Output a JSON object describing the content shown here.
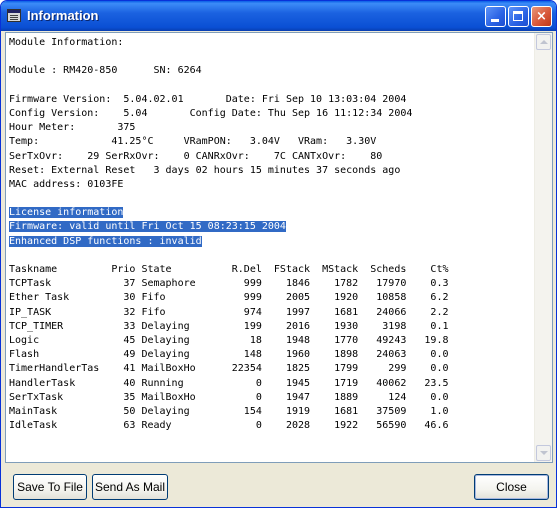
{
  "window": {
    "title": "Information",
    "icon": "terminal-window-icon",
    "controls": {
      "minimize": "minimize",
      "maximize": "maximize",
      "close": "×"
    }
  },
  "report": {
    "lines": [
      "Module Information:",
      "",
      "Module : RM420-850      SN: 6264",
      "",
      "Firmware Version:  5.04.02.01       Date: Fri Sep 10 13:03:04 2004",
      "Config Version:    5.04       Config Date: Thu Sep 16 11:12:34 2004",
      "Hour Meter:       375",
      "Temp:            41.25°C     VRamPON:   3.04V   VRam:   3.30V",
      "SerTxOvr:    29 SerRxOvr:    0 CANRxOvr:    7C CANTxOvr:    80",
      "Reset: External Reset   3 days 02 hours 15 minutes 37 seconds ago",
      "MAC address: 0103FE",
      "",
      "License information",
      "Firmware: valid until Fri Oct 15 08:23:15 2004",
      "Enhanced DSP functions : invalid",
      "",
      "Taskname         Prio State          R.Del  FStack  MStack  Scheds    Ct%",
      "TCPTask            37 Semaphore        999    1846    1782   17970    0.3",
      "Ether Task         30 Fifo             999    2005    1920   10858    6.2",
      "IP_TASK            32 Fifo             974    1997    1681   24066    2.2",
      "TCP_TIMER          33 Delaying         199    2016    1930    3198    0.1",
      "Logic              45 Delaying          18    1948    1770   49243   19.8",
      "Flash              49 Delaying         148    1960    1898   24063    0.0",
      "TimerHandlerTas    41 MailBoxHo      22354    1825    1799     299    0.0",
      "HandlerTask        40 Running            0    1945    1719   40062   23.5",
      "SerTxTask          35 MailBoxHo          0    1947    1889     124    0.0",
      "MainTask           50 Delaying         154    1919    1681   37509    1.0",
      "IdleTask           63 Ready              0    2028    1922   56590   46.6"
    ],
    "selected_lines": [
      12,
      13,
      14
    ]
  },
  "buttons": {
    "save": "Save To File",
    "mail": "Send As Mail",
    "close": "Close"
  },
  "colors": {
    "titlebar": "#0a4fd4",
    "selection": "#316ac5",
    "button_border": "#003c74"
  }
}
